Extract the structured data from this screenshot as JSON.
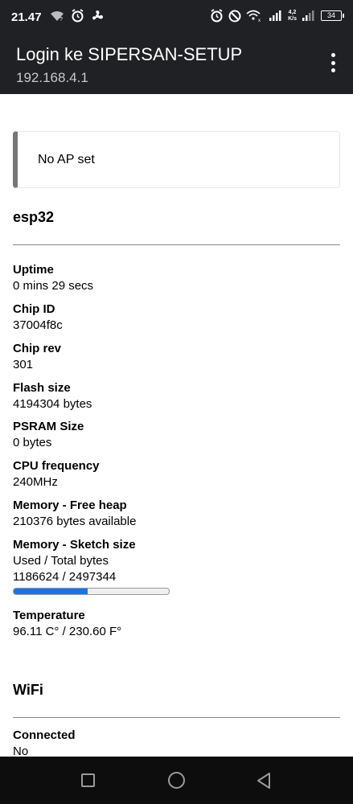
{
  "status_bar": {
    "time": "21.47",
    "speed_value": "4,2",
    "speed_unit": "K/s",
    "battery": "34",
    "icons": [
      "wifi-question-icon",
      "alarm-icon",
      "fan-icon",
      "alarm-icon",
      "do-not-disturb-icon",
      "wifi-signal-icon",
      "cell-signal-icon",
      "cell-signal-2-icon",
      "battery-icon"
    ]
  },
  "app_bar": {
    "title": "Login ke SIPERSAN-SETUP",
    "subtitle": "192.168.4.1",
    "menu_icon": "overflow-menu-icon"
  },
  "message": {
    "text": "No AP set"
  },
  "esp32": {
    "title": "esp32",
    "items": [
      {
        "label": "Uptime",
        "value": "0 mins 29 secs"
      },
      {
        "label": "Chip ID",
        "value": "37004f8c"
      },
      {
        "label": "Chip rev",
        "value": "301"
      },
      {
        "label": "Flash size",
        "value": "4194304 bytes"
      },
      {
        "label": "PSRAM Size",
        "value": "0 bytes"
      },
      {
        "label": "CPU frequency",
        "value": "240MHz"
      },
      {
        "label": "Memory - Free heap",
        "value": "210376 bytes available"
      },
      {
        "label": "Memory - Sketch size",
        "value": "Used / Total bytes",
        "value2": "1186624 / 2497344"
      },
      {
        "label": "Temperature",
        "value": "96.11 C° / 230.60 F°"
      }
    ],
    "sketch_usage_fraction": 0.475
  },
  "wifi": {
    "title": "WiFi",
    "items": [
      {
        "label": "Connected",
        "value": "No"
      }
    ]
  },
  "colors": {
    "bar_background": "#202124",
    "progress_fill": "#1a73e8",
    "message_border": "#777777"
  }
}
